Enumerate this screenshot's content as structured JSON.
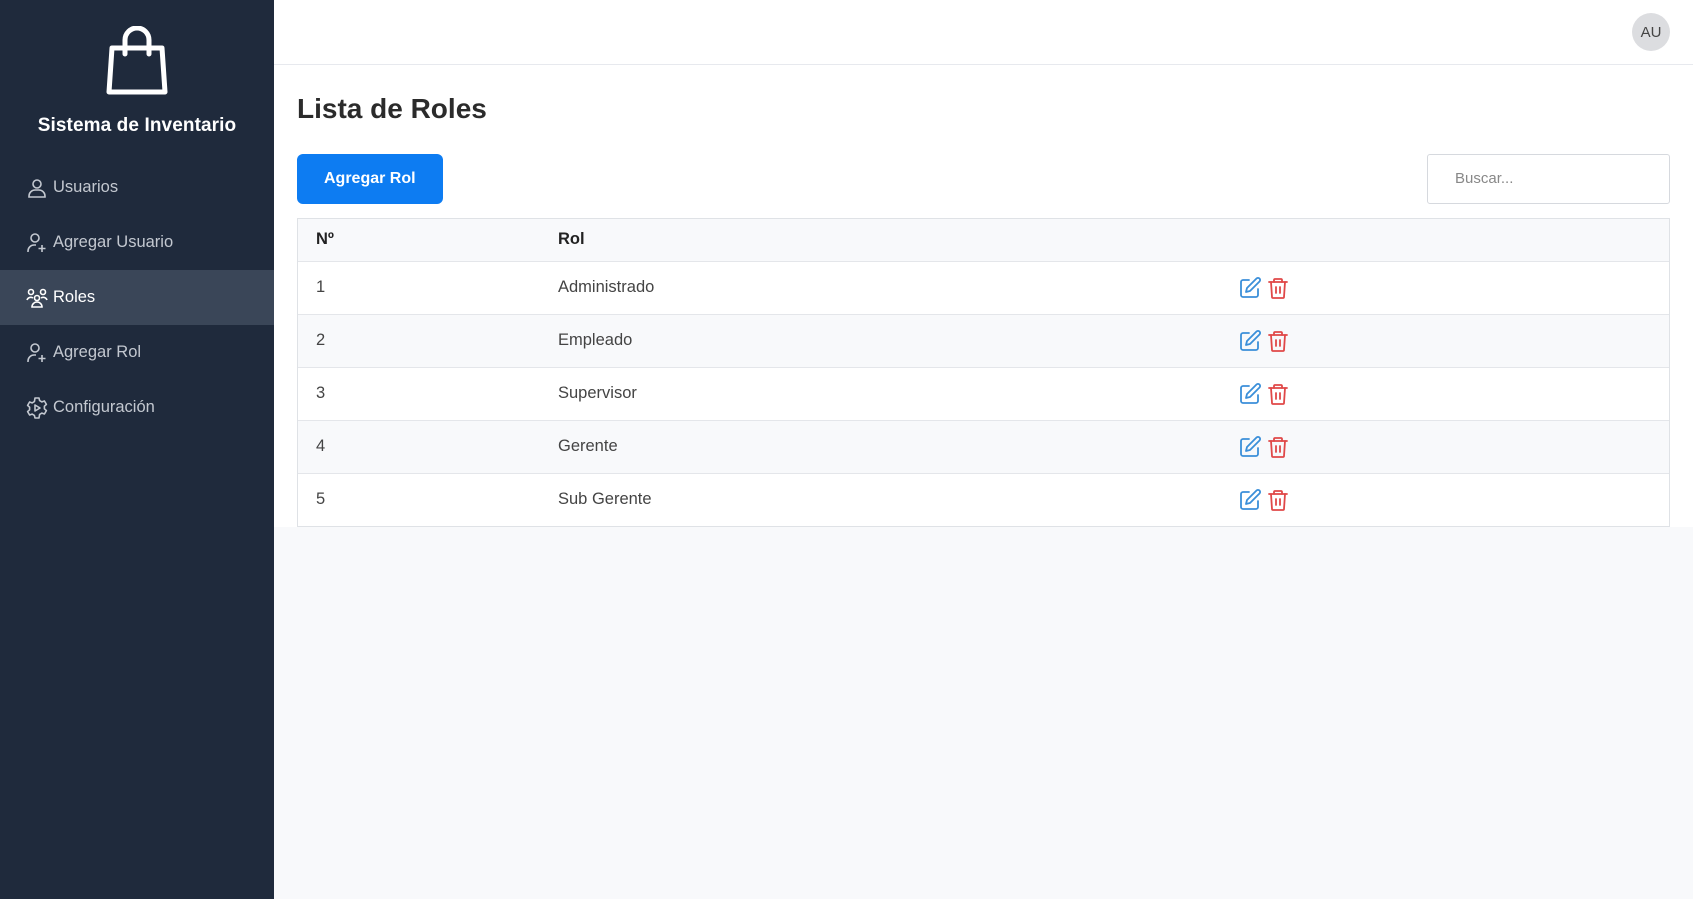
{
  "brand": {
    "title": "Sistema de Inventario"
  },
  "sidebar": {
    "items": [
      {
        "label": "Usuarios",
        "icon": "user-icon",
        "active": false
      },
      {
        "label": "Agregar Usuario",
        "icon": "user-plus-icon",
        "active": false
      },
      {
        "label": "Roles",
        "icon": "users-group-icon",
        "active": true
      },
      {
        "label": "Agregar Rol",
        "icon": "user-plus-icon",
        "active": false
      },
      {
        "label": "Configuración",
        "icon": "settings-icon",
        "active": false
      }
    ]
  },
  "topbar": {
    "avatar": "AU"
  },
  "page": {
    "title": "Lista de Roles",
    "add_button": "Agregar Rol",
    "search_placeholder": "Buscar..."
  },
  "table": {
    "headers": {
      "no": "Nº",
      "rol": "Rol"
    },
    "rows": [
      {
        "no": "1",
        "rol": "Administrado"
      },
      {
        "no": "2",
        "rol": "Empleado"
      },
      {
        "no": "3",
        "rol": "Supervisor"
      },
      {
        "no": "4",
        "rol": "Gerente"
      },
      {
        "no": "5",
        "rol": "Sub Gerente"
      }
    ]
  },
  "colors": {
    "sidebar_bg": "#1f2a3c",
    "sidebar_active": "#3a4658",
    "primary": "#0d7cf2",
    "edit_icon": "#3b8fd9",
    "delete_icon": "#e04848"
  }
}
